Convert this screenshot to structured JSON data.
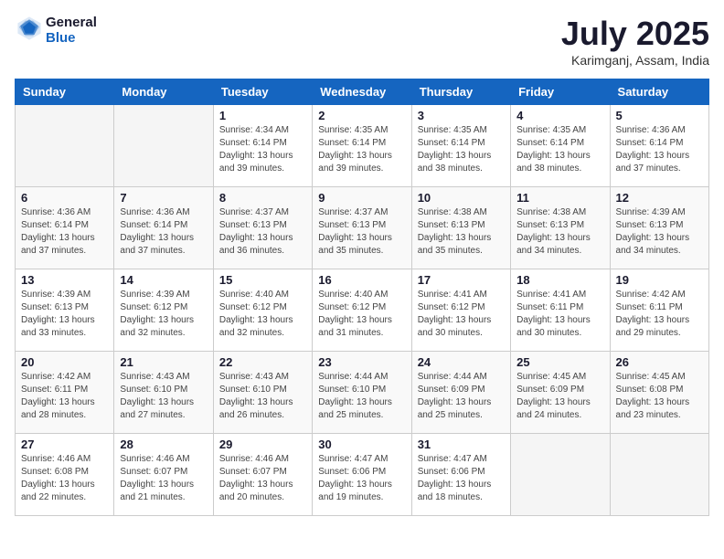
{
  "header": {
    "logo_general": "General",
    "logo_blue": "Blue",
    "month_title": "July 2025",
    "location": "Karimganj, Assam, India"
  },
  "weekdays": [
    "Sunday",
    "Monday",
    "Tuesday",
    "Wednesday",
    "Thursday",
    "Friday",
    "Saturday"
  ],
  "weeks": [
    [
      {
        "day": "",
        "info": ""
      },
      {
        "day": "",
        "info": ""
      },
      {
        "day": "1",
        "info": "Sunrise: 4:34 AM\nSunset: 6:14 PM\nDaylight: 13 hours and 39 minutes."
      },
      {
        "day": "2",
        "info": "Sunrise: 4:35 AM\nSunset: 6:14 PM\nDaylight: 13 hours and 39 minutes."
      },
      {
        "day": "3",
        "info": "Sunrise: 4:35 AM\nSunset: 6:14 PM\nDaylight: 13 hours and 38 minutes."
      },
      {
        "day": "4",
        "info": "Sunrise: 4:35 AM\nSunset: 6:14 PM\nDaylight: 13 hours and 38 minutes."
      },
      {
        "day": "5",
        "info": "Sunrise: 4:36 AM\nSunset: 6:14 PM\nDaylight: 13 hours and 37 minutes."
      }
    ],
    [
      {
        "day": "6",
        "info": "Sunrise: 4:36 AM\nSunset: 6:14 PM\nDaylight: 13 hours and 37 minutes."
      },
      {
        "day": "7",
        "info": "Sunrise: 4:36 AM\nSunset: 6:14 PM\nDaylight: 13 hours and 37 minutes."
      },
      {
        "day": "8",
        "info": "Sunrise: 4:37 AM\nSunset: 6:13 PM\nDaylight: 13 hours and 36 minutes."
      },
      {
        "day": "9",
        "info": "Sunrise: 4:37 AM\nSunset: 6:13 PM\nDaylight: 13 hours and 35 minutes."
      },
      {
        "day": "10",
        "info": "Sunrise: 4:38 AM\nSunset: 6:13 PM\nDaylight: 13 hours and 35 minutes."
      },
      {
        "day": "11",
        "info": "Sunrise: 4:38 AM\nSunset: 6:13 PM\nDaylight: 13 hours and 34 minutes."
      },
      {
        "day": "12",
        "info": "Sunrise: 4:39 AM\nSunset: 6:13 PM\nDaylight: 13 hours and 34 minutes."
      }
    ],
    [
      {
        "day": "13",
        "info": "Sunrise: 4:39 AM\nSunset: 6:13 PM\nDaylight: 13 hours and 33 minutes."
      },
      {
        "day": "14",
        "info": "Sunrise: 4:39 AM\nSunset: 6:12 PM\nDaylight: 13 hours and 32 minutes."
      },
      {
        "day": "15",
        "info": "Sunrise: 4:40 AM\nSunset: 6:12 PM\nDaylight: 13 hours and 32 minutes."
      },
      {
        "day": "16",
        "info": "Sunrise: 4:40 AM\nSunset: 6:12 PM\nDaylight: 13 hours and 31 minutes."
      },
      {
        "day": "17",
        "info": "Sunrise: 4:41 AM\nSunset: 6:12 PM\nDaylight: 13 hours and 30 minutes."
      },
      {
        "day": "18",
        "info": "Sunrise: 4:41 AM\nSunset: 6:11 PM\nDaylight: 13 hours and 30 minutes."
      },
      {
        "day": "19",
        "info": "Sunrise: 4:42 AM\nSunset: 6:11 PM\nDaylight: 13 hours and 29 minutes."
      }
    ],
    [
      {
        "day": "20",
        "info": "Sunrise: 4:42 AM\nSunset: 6:11 PM\nDaylight: 13 hours and 28 minutes."
      },
      {
        "day": "21",
        "info": "Sunrise: 4:43 AM\nSunset: 6:10 PM\nDaylight: 13 hours and 27 minutes."
      },
      {
        "day": "22",
        "info": "Sunrise: 4:43 AM\nSunset: 6:10 PM\nDaylight: 13 hours and 26 minutes."
      },
      {
        "day": "23",
        "info": "Sunrise: 4:44 AM\nSunset: 6:10 PM\nDaylight: 13 hours and 25 minutes."
      },
      {
        "day": "24",
        "info": "Sunrise: 4:44 AM\nSunset: 6:09 PM\nDaylight: 13 hours and 25 minutes."
      },
      {
        "day": "25",
        "info": "Sunrise: 4:45 AM\nSunset: 6:09 PM\nDaylight: 13 hours and 24 minutes."
      },
      {
        "day": "26",
        "info": "Sunrise: 4:45 AM\nSunset: 6:08 PM\nDaylight: 13 hours and 23 minutes."
      }
    ],
    [
      {
        "day": "27",
        "info": "Sunrise: 4:46 AM\nSunset: 6:08 PM\nDaylight: 13 hours and 22 minutes."
      },
      {
        "day": "28",
        "info": "Sunrise: 4:46 AM\nSunset: 6:07 PM\nDaylight: 13 hours and 21 minutes."
      },
      {
        "day": "29",
        "info": "Sunrise: 4:46 AM\nSunset: 6:07 PM\nDaylight: 13 hours and 20 minutes."
      },
      {
        "day": "30",
        "info": "Sunrise: 4:47 AM\nSunset: 6:06 PM\nDaylight: 13 hours and 19 minutes."
      },
      {
        "day": "31",
        "info": "Sunrise: 4:47 AM\nSunset: 6:06 PM\nDaylight: 13 hours and 18 minutes."
      },
      {
        "day": "",
        "info": ""
      },
      {
        "day": "",
        "info": ""
      }
    ]
  ]
}
